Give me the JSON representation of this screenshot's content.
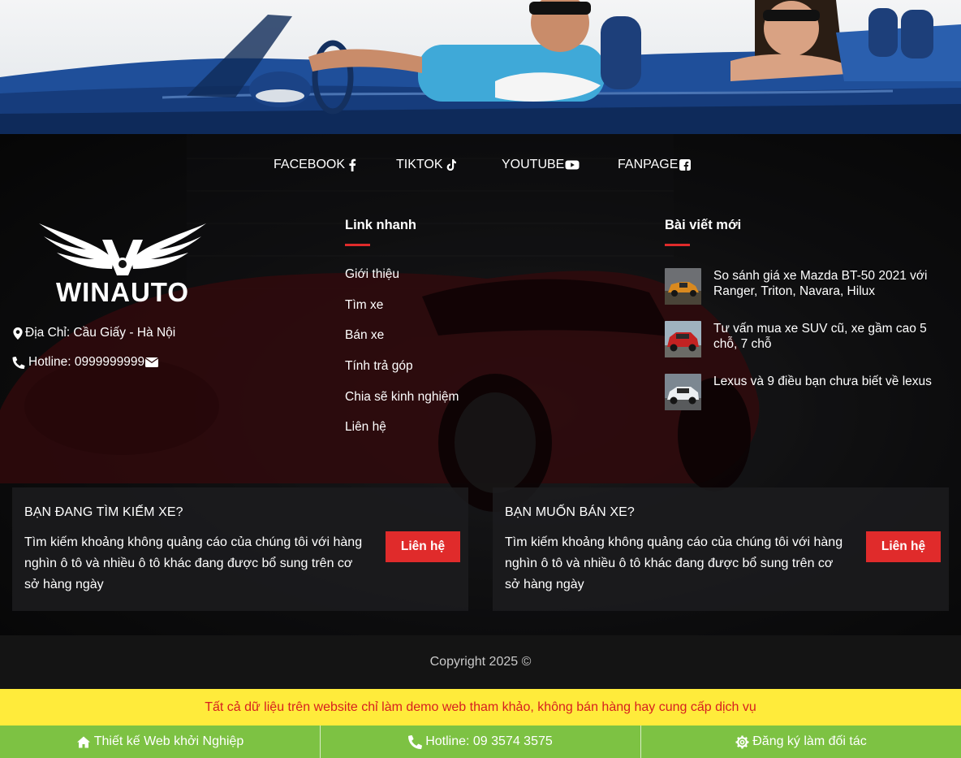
{
  "hero": {
    "alt": "convertible-car-banner"
  },
  "social": [
    {
      "label": "FACEBOOK",
      "icon": "facebook-icon"
    },
    {
      "label": "TIKTOK",
      "icon": "tiktok-icon"
    },
    {
      "label": "YOUTUBE",
      "icon": "youtube-icon"
    },
    {
      "label": "FANPAGE",
      "icon": "facebook-square-icon"
    }
  ],
  "brand": {
    "name": "WINAUTO"
  },
  "contact": {
    "address": "Địa Chỉ: Cầu Giấy - Hà Nội",
    "hotline": "Hotline: 0999999999"
  },
  "quick_links": {
    "title": "Link nhanh",
    "items": [
      "Giới thiệu",
      "Tìm xe",
      "Bán xe",
      "Tính trả góp",
      "Chia sẽ kinh nghiệm",
      "Liên hệ"
    ]
  },
  "recent_posts": {
    "title": "Bài viết mới",
    "items": [
      {
        "title": "So sánh giá xe Mazda BT-50 2021 với Ranger, Triton, Navara, Hilux"
      },
      {
        "title": "Tư vấn mua xe SUV cũ, xe gầm cao 5 chỗ, 7 chỗ"
      },
      {
        "title": "Lexus và 9 điều bạn chưa biết về lexus"
      }
    ]
  },
  "cta": [
    {
      "title": "BẠN ĐANG TÌM KIẾM XE?",
      "desc": "Tìm kiếm khoảng không quảng cáo của chúng tôi với hàng nghìn ô tô và nhiều ô tô khác đang được bổ sung trên cơ sở hàng ngày",
      "button": "Liên hệ"
    },
    {
      "title": "BẠN MUỐN BÁN XE?",
      "desc": "Tìm kiếm khoảng không quảng cáo của chúng tôi với hàng nghìn ô tô và nhiều ô tô khác đang được bổ sung trên cơ sở hàng ngày",
      "button": "Liên hệ"
    }
  ],
  "copyright": "Copyright 2025 ©",
  "notice": "Tất cả dữ liệu trên website chỉ làm demo web tham khảo, không bán hàng hay cung cấp dịch vụ",
  "bottom_bar": [
    {
      "label": "Thiết kế Web khởi Nghiệp",
      "icon": "home-icon"
    },
    {
      "label": "Hotline: 09 3574 3575",
      "icon": "phone-icon"
    },
    {
      "label": "Đăng ký làm đối tác",
      "icon": "gear-icon"
    }
  ],
  "colors": {
    "accent": "#e02b2b",
    "notice_bg": "#ffeb3b",
    "bottom_bar_bg": "#7dc243"
  }
}
